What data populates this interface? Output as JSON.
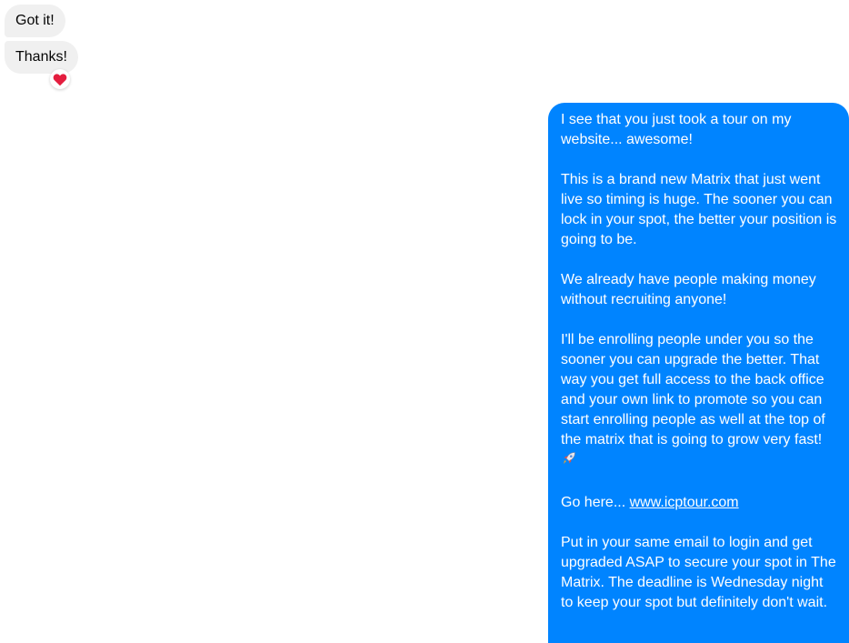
{
  "incoming": [
    {
      "text": "Got it!"
    },
    {
      "text": "Thanks!",
      "reaction": "heart-icon"
    }
  ],
  "outgoing": {
    "p1": "I see that you just took a tour on my website... awesome!",
    "p2": "This is a brand new Matrix that just went live so timing is huge. The sooner you can lock in your spot, the better your position is going to be.",
    "p3": "We already have people making money without recruiting anyone!",
    "p4": " I'll be enrolling people under you so the sooner you can upgrade the better. That way you get full access to the back office and your own link to promote so you can start enrolling people as well at the top of the matrix that is going to grow very fast!",
    "p4_icon": "rocket-icon",
    "p5_prefix": "Go here... ",
    "p5_link": "www.icptour.com",
    "p6": "Put in your same email to login and get upgraded ASAP to secure your spot in The Matrix.  The deadline is Wednesday night to keep your spot but definitely don't wait."
  },
  "colors": {
    "outgoing_bubble": "#0084ff",
    "incoming_bubble": "#f0f0f0",
    "reaction_heart": "#e41e3f"
  }
}
